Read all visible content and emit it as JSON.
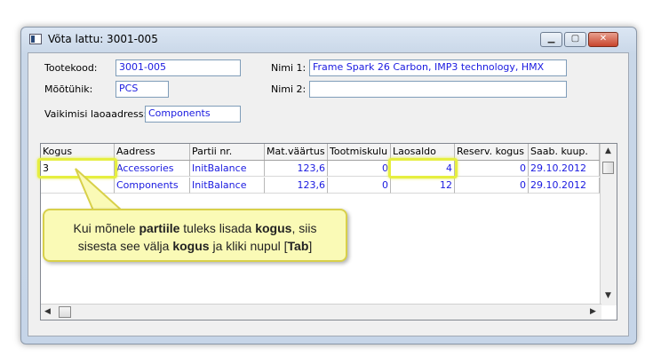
{
  "window": {
    "title": "Võta lattu: 3001-005"
  },
  "form": {
    "tootekood_label": "Tootekood:",
    "tootekood_value": "3001-005",
    "mootuhik_label": "Mõõtühik:",
    "mootuhik_value": "PCS",
    "vaikimisi_label": "Vaikimisi laoaadress:",
    "vaikimisi_value": "Components",
    "nimi1_label": "Nimi 1:",
    "nimi1_value": "Frame Spark 26 Carbon, IMP3 technology, HMX",
    "nimi2_label": "Nimi 2:",
    "nimi2_value": ""
  },
  "grid": {
    "headers": [
      "Kogus",
      "Aadress",
      "Partii nr.",
      "Mat.väärtus",
      "Tootmiskulu",
      "Laosaldo",
      "Reserv. kogus",
      "Saab. kuup."
    ],
    "rows": [
      [
        "3",
        "Accessories",
        "InitBalance",
        "123,6",
        "0",
        "4",
        "0",
        "29.10.2012"
      ],
      [
        "",
        "Components",
        "InitBalance",
        "123,6",
        "0",
        "12",
        "0",
        "29.10.2012"
      ]
    ]
  },
  "callout": {
    "l1_a": "Kui mõnele ",
    "l1_b": "partiile",
    "l1_c": " tuleks lisada ",
    "l1_d": "kogus",
    "l1_e": ", siis",
    "l2_a": "sisesta see välja ",
    "l2_b": "kogus",
    "l2_c": " ja kliki nupul [",
    "l2_d": "Tab",
    "l2_e": "]"
  },
  "icons": {
    "minimize": "minimize-icon",
    "maximize": "maximize-icon",
    "close": "close-icon"
  },
  "colors": {
    "value_text": "#1a1ae0",
    "highlight": "#e6ef40",
    "callout_bg": "#fafab6"
  }
}
